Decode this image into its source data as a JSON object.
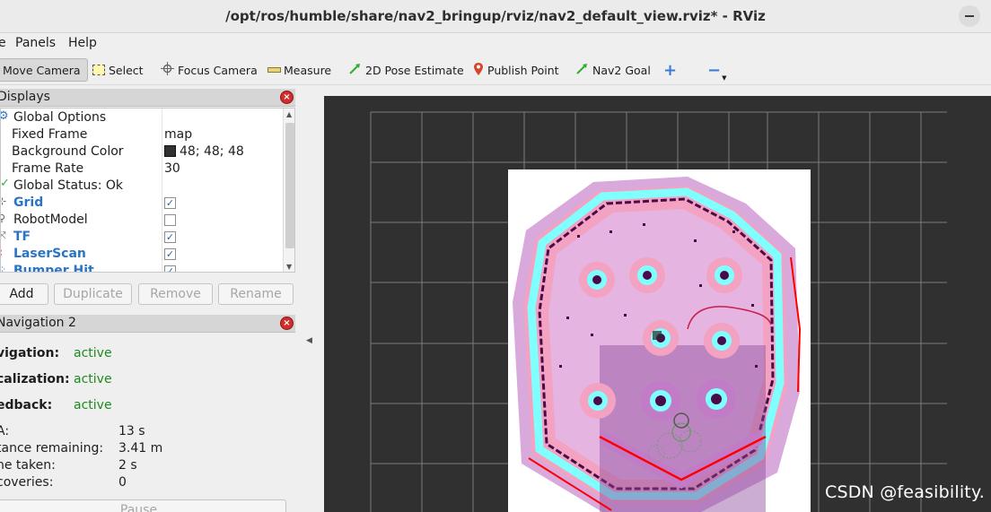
{
  "window": {
    "title": "/opt/ros/humble/share/nav2_bringup/rviz/nav2_default_view.rviz* - RViz"
  },
  "menu": {
    "file_fragment": "e",
    "panels": "Panels",
    "help": "Help"
  },
  "toolbar": {
    "move_camera": "Move Camera",
    "select": "Select",
    "focus_camera": "Focus Camera",
    "measure": "Measure",
    "pose_estimate": "2D Pose Estimate",
    "publish_point": "Publish Point",
    "nav2_goal": "Nav2 Goal",
    "add_icon": "plus-icon",
    "remove_icon": "minus-icon"
  },
  "displays": {
    "title": "Displays",
    "rows": [
      {
        "label": "Global Options"
      },
      {
        "label": "Fixed Frame",
        "value": "map"
      },
      {
        "label": "Background Color",
        "value": "48; 48; 48",
        "color": "#303030"
      },
      {
        "label": "Frame Rate",
        "value": "30"
      },
      {
        "label": "Global Status: Ok"
      },
      {
        "label": "Grid",
        "checked": true
      },
      {
        "label": "RobotModel",
        "checked": false
      },
      {
        "label": "TF",
        "checked": true
      },
      {
        "label": "LaserScan",
        "checked": true
      },
      {
        "label": "Bumper Hit",
        "checked": true
      }
    ],
    "buttons": {
      "add": "Add",
      "duplicate": "Duplicate",
      "remove": "Remove",
      "rename": "Rename"
    }
  },
  "navigation": {
    "title": "Navigation 2",
    "navigation_label": "vigation:",
    "navigation_value": "active",
    "localization_label": "calization:",
    "localization_value": "active",
    "feedback_label": "edback:",
    "feedback_value": "active",
    "eta_label": "A:",
    "eta_value": "13 s",
    "distance_label": "tance remaining:",
    "distance_value": "3.41 m",
    "time_label": "ne taken:",
    "time_value": "2 s",
    "recoveries_label": "coveries:",
    "recoveries_value": "0",
    "pause_button": "Pause"
  },
  "watermark": "CSDN @feasibility.",
  "colors": {
    "background": "#303030",
    "grid": "#8a8a8a",
    "costmap_free": "#ffffff",
    "inflation_outer": "#d7a6d7",
    "inflation_inner": "#f2a3c0",
    "cyan": "#80ffff",
    "obstacle": "#4a0a4a",
    "lethal": "#ff0000",
    "active_green": "#1c8a1c"
  }
}
